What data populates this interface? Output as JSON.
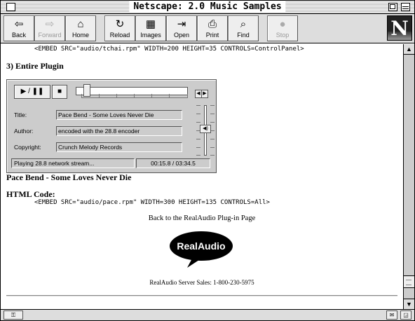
{
  "window": {
    "title": "Netscape: 2.0 Music Samples"
  },
  "toolbar": {
    "buttons": [
      {
        "label": "Back",
        "icon": "back-arrow-icon",
        "glyph": "⇦"
      },
      {
        "label": "Forward",
        "icon": "forward-arrow-icon",
        "glyph": "⇨"
      },
      {
        "label": "Home",
        "icon": "home-icon",
        "glyph": "⌂"
      },
      {
        "label": "Reload",
        "icon": "reload-icon",
        "glyph": "↻"
      },
      {
        "label": "Images",
        "icon": "images-icon",
        "glyph": "▦"
      },
      {
        "label": "Open",
        "icon": "open-icon",
        "glyph": "⇥"
      },
      {
        "label": "Print",
        "icon": "printer-icon",
        "glyph": "⎙"
      },
      {
        "label": "Find",
        "icon": "find-icon",
        "glyph": "⌕"
      },
      {
        "label": "Stop",
        "icon": "stop-icon",
        "glyph": "●"
      }
    ],
    "logo_letter": "N"
  },
  "content": {
    "embed_line_1": "<EMBED SRC=\"audio/tchai.rpm\" WIDTH=200 HEIGHT=35 CONTROLS=ControlPanel>",
    "section_heading": "3) Entire Plugin",
    "plugin": {
      "play_pause_label": "▶ / ❚❚",
      "stop_label": "■",
      "title_label": "Title:",
      "title_value": "Pace Bend - Some Loves Never Die",
      "author_label": "Author:",
      "author_value": "encoded with the 28.8 encoder",
      "copyright_label": "Copyright:",
      "copyright_value": "Crunch Melody Records",
      "status_text": "Playing 28.8 network stream...",
      "time_text": "00:15.8 / 03:34.5",
      "position_fraction": 0.07
    },
    "song_title": "Pace Bend - Some Loves Never Die",
    "html_code_heading": "HTML Code:",
    "embed_line_2": "<EMBED SRC=\"audio/pace.rpm\" WIDTH=300 HEIGHT=135 CONTROLS=All>",
    "back_link": "Back to the RealAudio Plug-in Page",
    "logo_text": "RealAudio",
    "server_sales": "RealAudio Server Sales: 1-800-230-5975"
  },
  "colors": {
    "chrome": "#dddddd",
    "plugin_bg": "#cccccc",
    "logo_bg": "#000000"
  }
}
